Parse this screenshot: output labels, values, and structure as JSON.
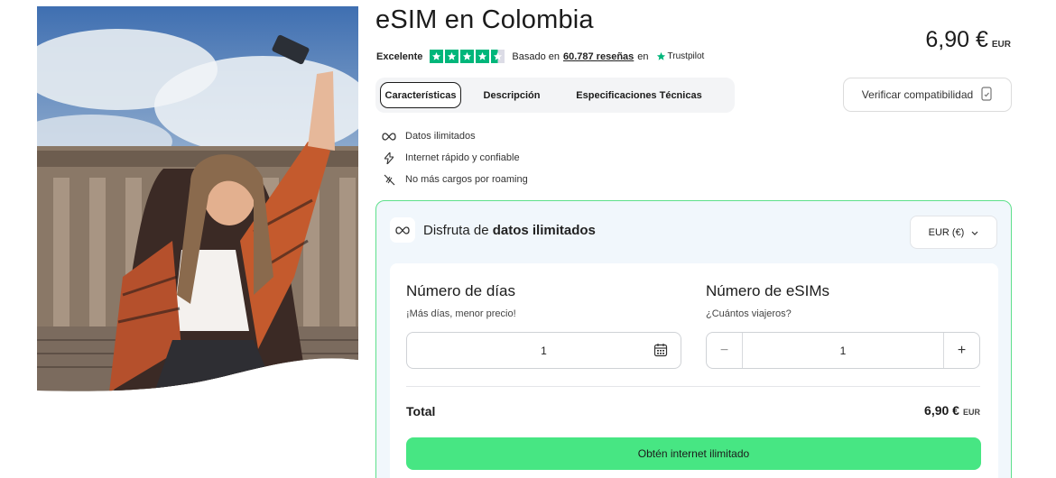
{
  "product": {
    "title": "eSIM en Colombia",
    "price": "6,90 €",
    "currency_code": "EUR"
  },
  "rating": {
    "label": "Excelente",
    "stars": 4.5,
    "based_prefix": "Basado en",
    "reviews_link": "60.787 reseñas",
    "based_suffix": "en",
    "provider": "Trustpilot",
    "star_color": "#00b67a"
  },
  "tabs": [
    {
      "label": "Características",
      "active": true
    },
    {
      "label": "Descripción",
      "active": false
    },
    {
      "label": "Especificaciones Técnicas",
      "active": false
    }
  ],
  "compat_button": {
    "label": "Verificar compatibilidad",
    "icon": "phone-check-icon"
  },
  "features": [
    {
      "icon": "infinity-icon",
      "label": "Datos ilimitados"
    },
    {
      "icon": "bolt-icon",
      "label": "Internet rápido y confiable"
    },
    {
      "icon": "no-roaming-icon",
      "label": "No más cargos por roaming"
    }
  ],
  "plan_card": {
    "heading_prefix": "Disfruta de",
    "heading_bold": "datos ilimitados",
    "currency_select": "EUR (€)",
    "days": {
      "title": "Número de días",
      "subtitle": "¡Más días, menor precio!",
      "value": "1"
    },
    "esims": {
      "title": "Número de eSIMs",
      "subtitle": "¿Cuántos viajeros?",
      "value": "1",
      "minus": "−",
      "plus": "+"
    },
    "total_label": "Total",
    "total_value": "6,90 €",
    "total_currency": "EUR",
    "cta": "Obtén internet ilimitado"
  },
  "colors": {
    "accent_green": "#47e683",
    "card_border": "#5ee08b",
    "card_bg": "#f1f7fc"
  }
}
